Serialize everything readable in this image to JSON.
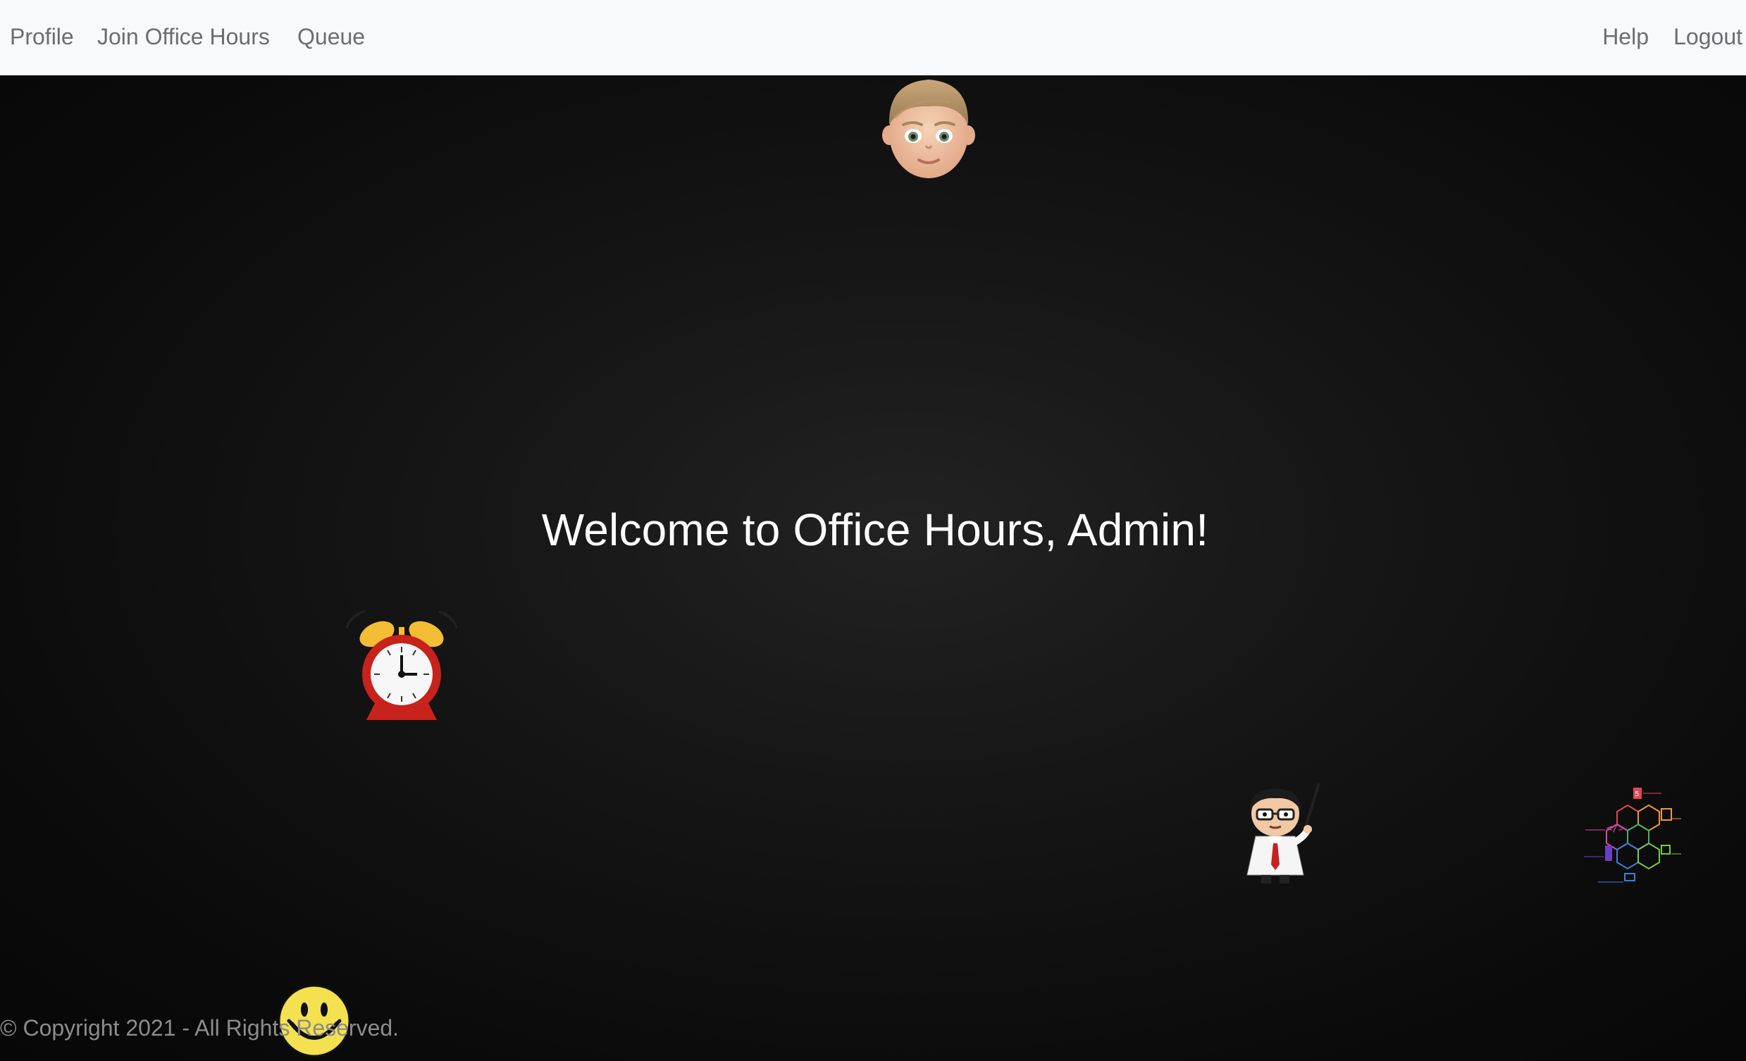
{
  "navbar": {
    "left_links": [
      "Profile",
      "Join Office Hours",
      "Queue"
    ],
    "right_links": [
      "Help",
      "Logout"
    ]
  },
  "main": {
    "welcome_message": "Welcome to Office Hours, Admin!"
  },
  "footer": {
    "copyright": "© Copyright 2021 - All Rights Reserved."
  },
  "decorations": {
    "icons": [
      "memoji-boy-icon",
      "alarm-clock-icon",
      "professor-cartoon-icon",
      "web-skills-hexagon-icon",
      "smiley-face-icon"
    ]
  },
  "colors": {
    "navbar_bg": "#f8f9fa",
    "nav_text": "#6c6d70",
    "hero_bg": "#111111",
    "welcome_text": "#ffffff",
    "footer_text": "#8c8c8c"
  }
}
